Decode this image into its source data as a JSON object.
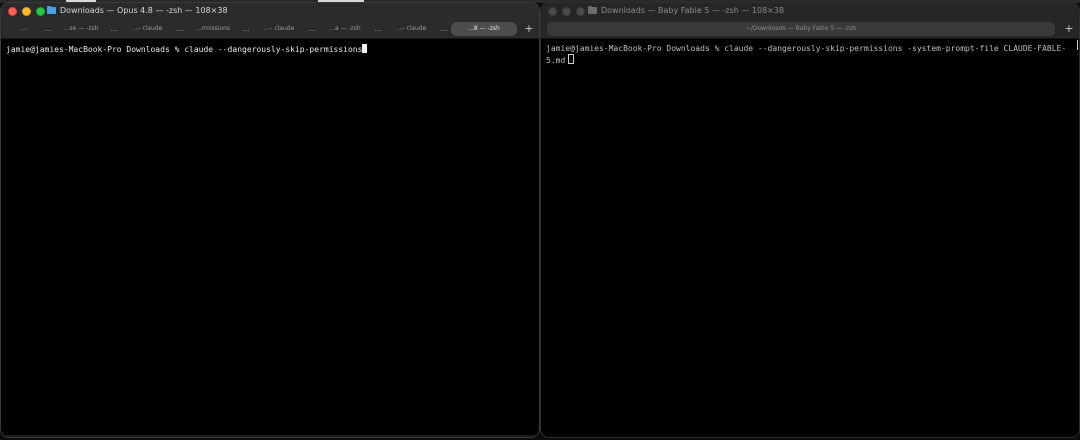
{
  "left_window": {
    "title": "Downloads — Opus 4.8 — -zsh — 108×38",
    "tabs": [
      {
        "label": "...-",
        "active": false
      },
      {
        "label": "...se — -zsh",
        "active": false
      },
      {
        "label": "...– claude",
        "active": false
      },
      {
        "label": "...rmissions",
        "active": false
      },
      {
        "label": "...– claude",
        "active": false
      },
      {
        "label": "...a — -zsh",
        "active": false
      },
      {
        "label": "...– claude",
        "active": false
      },
      {
        "label": "...8 — -zsh",
        "active": true
      }
    ],
    "separator": "...",
    "new_tab_label": "+",
    "prompt_line": "jamie@jamies-MacBook-Pro Downloads % claude --dangerously-skip-permissions"
  },
  "right_window": {
    "title": "Downloads — Baby Fable 5 — -zsh — 108×38",
    "tab_label": "~/Downloads — Baby Fable 5 — -zsh",
    "new_tab_label": "+",
    "prompt_line_1": "jamie@jamies-MacBook-Pro Downloads % claude --dangerously-skip-permissions -system-prompt-file CLAUDE-FABLE-",
    "prompt_line_2": "5.md"
  },
  "colors": {
    "close": "#fe5f57",
    "minimize": "#febc2e",
    "zoom": "#28c840",
    "terminal_bg": "#000000",
    "titlebar": "#2b2b2d"
  }
}
